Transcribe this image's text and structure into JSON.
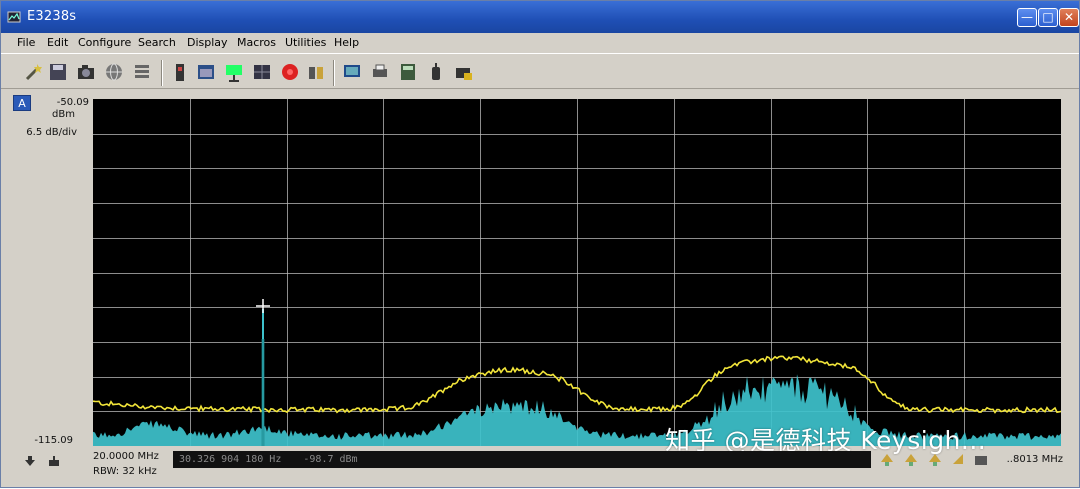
{
  "window": {
    "title": "E3238s"
  },
  "menu": [
    "File",
    "Edit",
    "Configure",
    "Search",
    "Display",
    "Macros",
    "Utilities",
    "Help"
  ],
  "toolbar_icons": [
    "tool-wand-icon",
    "disk-icon",
    "camera-icon",
    "globe-icon",
    "list-icon",
    "battery-icon",
    "window-icon",
    "antenna-icon",
    "grid-icon",
    "record-icon",
    "people-icon",
    "monitor-icon",
    "printer-icon",
    "calculator-icon",
    "device-icon",
    "folder-icon"
  ],
  "display": {
    "trace_label": "A",
    "ref_level": "-50.09",
    "ref_unit": "dBm",
    "scale": "6.5 dB/div",
    "bottom_level": "-115.09"
  },
  "status": {
    "start_freq": "20.0000 MHz",
    "rbw": "RBW: 32 kHz",
    "marker_freq": "30.326 904 180 Hz",
    "marker_level": "-98.7 dBm",
    "stop_freq": "..8013 MHz"
  },
  "watermark": "知乎 @是德科技 Keysigh...",
  "colors": {
    "max_hold": "#f2e53a",
    "live": "#3ec2cc",
    "grid": "#bdbdbd"
  }
}
